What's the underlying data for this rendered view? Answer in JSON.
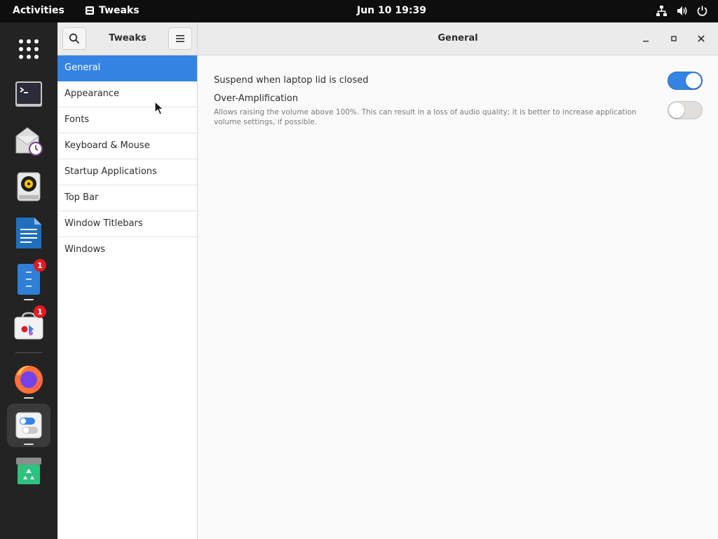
{
  "topbar": {
    "activities": "Activities",
    "app_name": "Tweaks",
    "clock": "Jun 10  19:39",
    "tray_icons": [
      "network-icon",
      "volume-icon",
      "power-icon"
    ]
  },
  "dock": {
    "badges": {
      "files": "1",
      "software": "1"
    }
  },
  "window": {
    "sidebar_title": "Tweaks",
    "main_title": "General",
    "sidebar_items": [
      {
        "label": "General",
        "selected": true
      },
      {
        "label": "Appearance"
      },
      {
        "label": "Fonts"
      },
      {
        "label": "Keyboard & Mouse"
      },
      {
        "label": "Startup Applications"
      },
      {
        "label": "Top Bar"
      },
      {
        "label": "Window Titlebars"
      },
      {
        "label": "Windows"
      }
    ],
    "settings": [
      {
        "label": "Suspend when laptop lid is closed",
        "enabled": true
      },
      {
        "label": "Over-Amplification",
        "description": "Allows raising the volume above 100%. This can result in a loss of audio quality; it is better to increase application volume settings, if possible.",
        "enabled": false
      }
    ]
  },
  "colors": {
    "accent": "#3584e4",
    "badge": "#e01b24"
  }
}
